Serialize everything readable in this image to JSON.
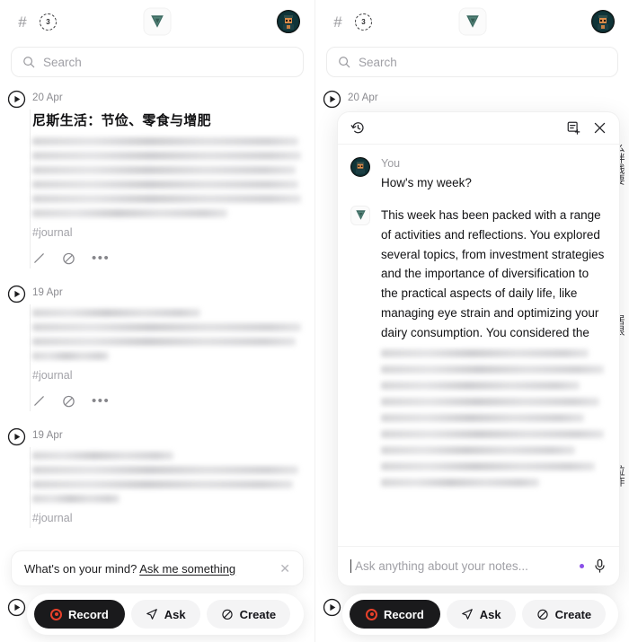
{
  "header": {
    "hash_icon": "hash-icon",
    "badge_count": "3",
    "logo_icon": "app-logo-triangle",
    "avatar_icon": "user-avatar"
  },
  "search": {
    "placeholder": "Search"
  },
  "left_panel": {
    "entries": [
      {
        "date": "20 Apr",
        "title": "尼斯生活：节俭、零食与增肥",
        "tag": "#journal",
        "blur_lines": 6
      },
      {
        "date": "19 Apr",
        "title": "",
        "tag": "#journal",
        "blur_lines": 4
      },
      {
        "date": "19 Apr",
        "title": "",
        "tag": "#journal",
        "blur_lines": 4
      }
    ],
    "prompt": {
      "lead": "What's on your mind? ",
      "link": "Ask me something",
      "close_icon": "close-icon"
    }
  },
  "right_panel": {
    "entries": [
      {
        "date": "20 Apr"
      }
    ],
    "chat": {
      "history_icon": "history-icon",
      "new_note_icon": "new-note-icon",
      "close_icon": "close-icon",
      "messages": [
        {
          "author": "You",
          "text": "How's my week?",
          "avatar_icon": "user-avatar"
        },
        {
          "author": "",
          "text": "This week has been packed with a range of activities and reflections. You explored several topics, from investment strategies and the importance of diversification to the practical aspects of daily life, like managing eye strain and optimizing your dairy consumption. You considered the",
          "avatar_icon": "assistant-logo",
          "blur_lines": 9
        }
      ],
      "input": {
        "placeholder": "Ask anything about your notes...",
        "dot_color": "#8a4fe8",
        "mic_icon": "microphone-icon"
      }
    },
    "peek_text_top": "么胖钱要",
    "peek_text_mid": "居很",
    "peek_text_bottom": "拉昨"
  },
  "toolbar": {
    "record_label": "Record",
    "ask_label": "Ask",
    "create_label": "Create",
    "record_icon": "record-dot-icon",
    "ask_icon": "paper-plane-icon",
    "create_icon": "sparkle-circle-icon"
  },
  "colors": {
    "record_bg": "#1a1a1c",
    "record_accent": "#e8402a",
    "logo_green": "#2f5d55",
    "accent_purple": "#8a4fe8"
  }
}
